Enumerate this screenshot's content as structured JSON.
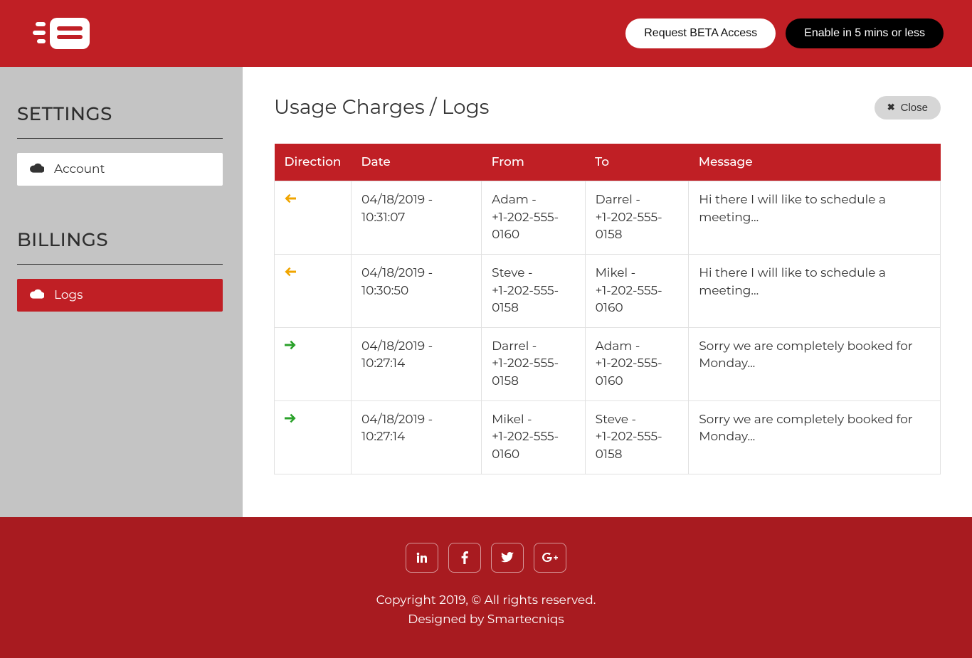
{
  "header": {
    "beta_button": "Request BETA Access",
    "enable_button": "Enable in 5 mins or less"
  },
  "sidebar": {
    "settings_heading": "SETTINGS",
    "account_label": "Account",
    "billings_heading": "BILLINGS",
    "logs_label": "Logs"
  },
  "main": {
    "title": "Usage Charges / Logs",
    "close_label": "Close",
    "columns": {
      "direction": "Direction",
      "date": "Date",
      "from": "From",
      "to": "To",
      "message": "Message"
    },
    "rows": [
      {
        "direction": "in",
        "date": "04/18/2019 - 10:31:07",
        "from": "Adam -\n+1-202-555-0160",
        "to": "Darrel -\n+1-202-555-0158",
        "message": "Hi there I will like to schedule a meeting..."
      },
      {
        "direction": "in",
        "date": "04/18/2019 - 10:30:50",
        "from": "Steve -\n+1-202-555-0158",
        "to": "Mikel -\n+1-202-555-0160",
        "message": "Hi there I will like to schedule a meeting..."
      },
      {
        "direction": "out",
        "date": "04/18/2019 - 10:27:14",
        "from": "Darrel -\n+1-202-555-0158",
        "to": "Adam -\n+1-202-555-0160",
        "message": "Sorry we are completely booked for Monday..."
      },
      {
        "direction": "out",
        "date": "04/18/2019 - 10:27:14",
        "from": "Mikel -\n+1-202-555-0160",
        "to": "Steve -\n+1-202-555-0158",
        "message": "Sorry we are completely booked for Monday..."
      }
    ]
  },
  "footer": {
    "copyright": "Copyright 2019, © All rights reserved.",
    "designed_prefix": "Designed by ",
    "designer": "Smartecniqs"
  }
}
